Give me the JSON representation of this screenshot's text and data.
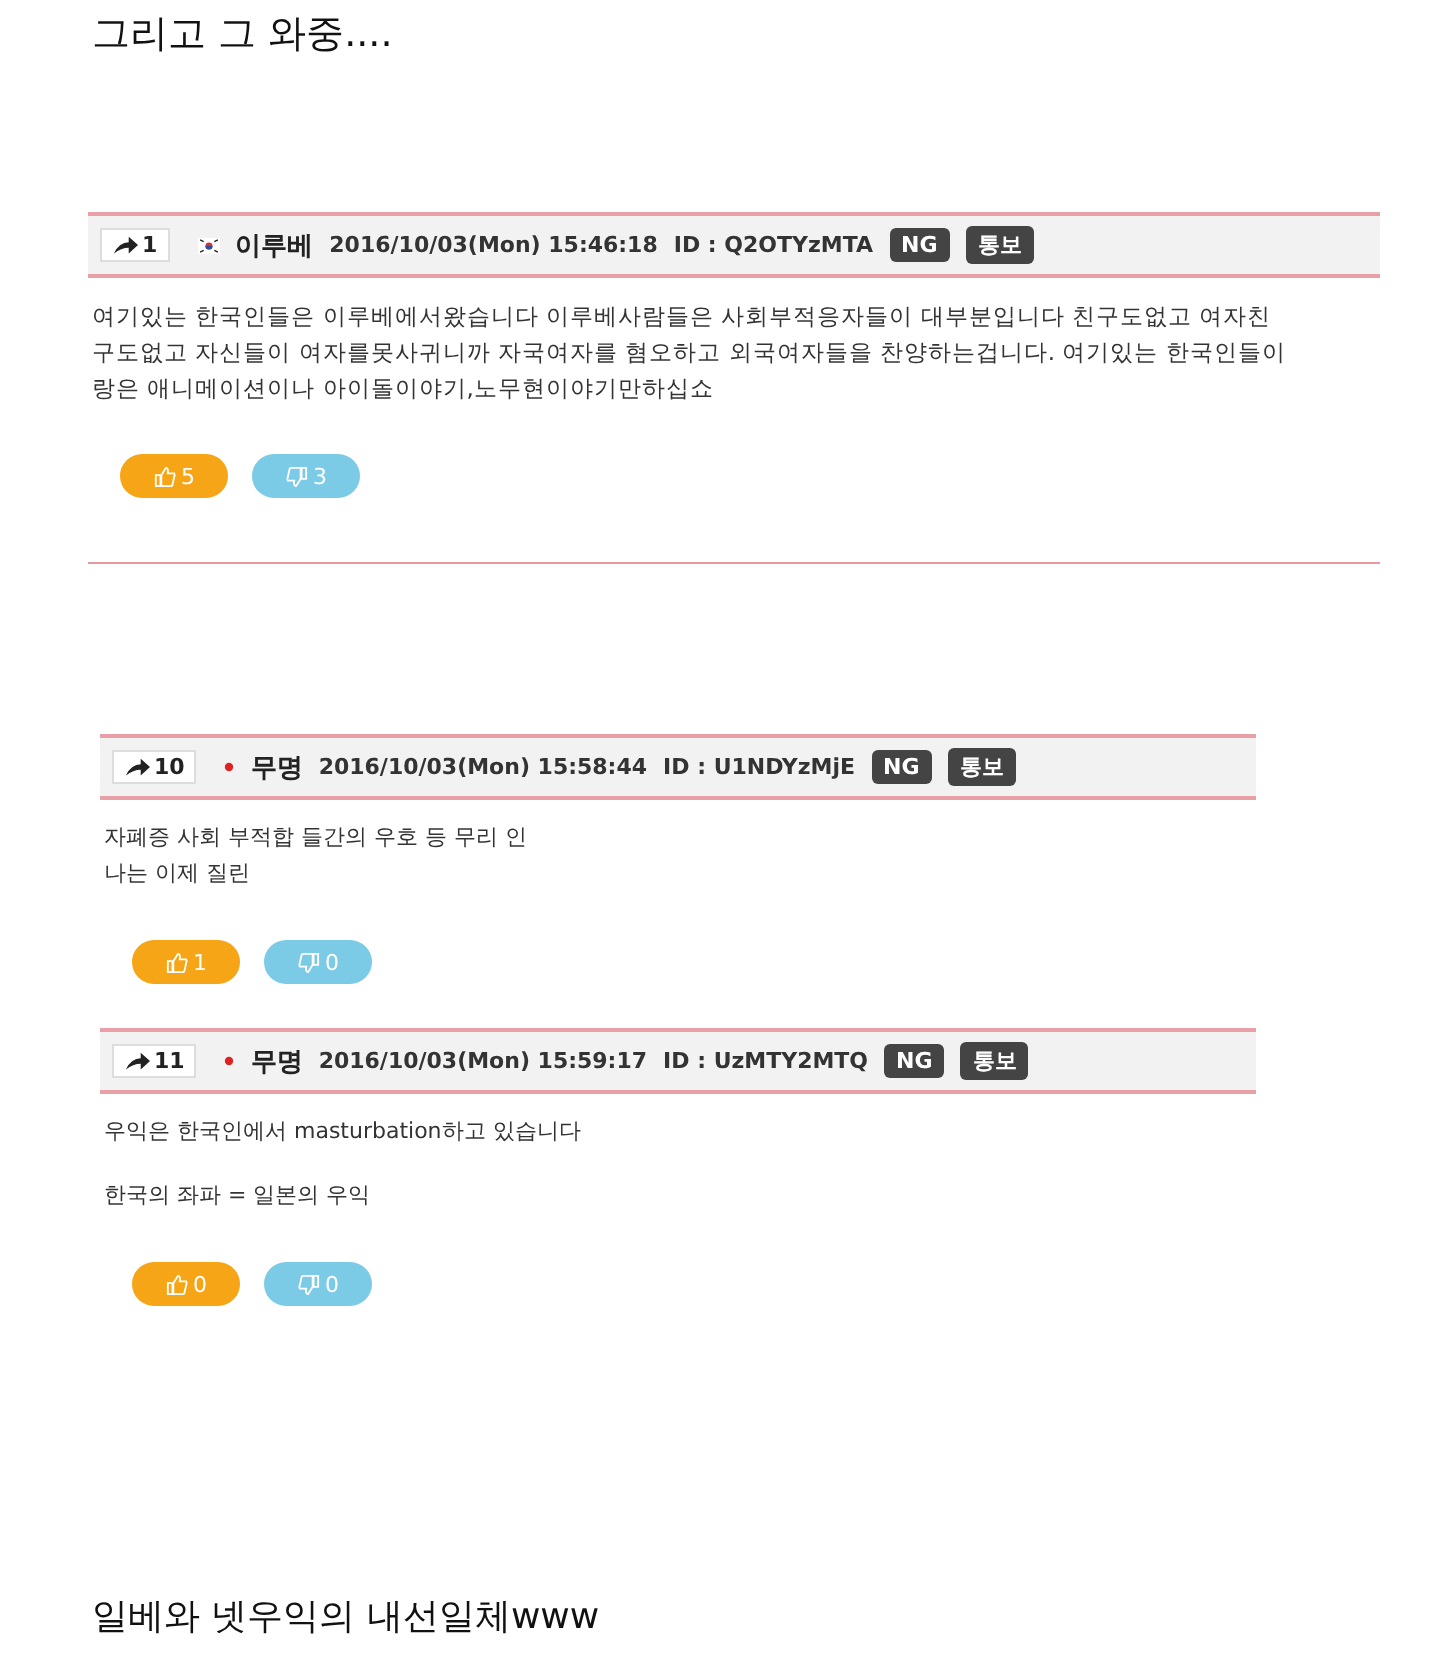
{
  "heading": "그리고 그 와중....",
  "sections": [
    {
      "comments": [
        {
          "number": "1",
          "kind": "flag",
          "name": "이루베",
          "date": "2016/10/03(Mon) 15:46:18",
          "id": "ID : Q2OTYzMTA",
          "ng": "NG",
          "report": "통보",
          "paragraphs": [
            [
              "여기있는 한국인들은 이루베에서왔습니다 이루베사람들은 사회부적응자들이 대부분입니다 친구도없고 여자친",
              "구도없고 자신들이 여자를못사귀니까 자국여자를 혐오하고 외국여자들을 찬양하는겁니다. 여기있는 한국인들이",
              "랑은 애니메이션이나 아이돌이야기,노무현이야기만하십쇼"
            ]
          ],
          "likes": "5",
          "dislikes": "3"
        }
      ]
    },
    {
      "comments": [
        {
          "number": "10",
          "kind": "dot",
          "name": "무명",
          "date": "2016/10/03(Mon) 15:58:44",
          "id": "ID : U1NDYzMjE",
          "ng": "NG",
          "report": "통보",
          "paragraphs": [
            [
              "자폐증 사회 부적합 들간의 우호 등 무리 인",
              "나는 이제 질린"
            ]
          ],
          "likes": "1",
          "dislikes": "0"
        },
        {
          "number": "11",
          "kind": "dot",
          "name": "무명",
          "date": "2016/10/03(Mon) 15:59:17",
          "id": "ID : UzMTY2MTQ",
          "ng": "NG",
          "report": "통보",
          "paragraphs": [
            [
              "우익은 한국인에서 masturbation하고 있습니다"
            ],
            [
              "한국의 좌파 = 일본의 우익"
            ]
          ],
          "likes": "0",
          "dislikes": "0"
        }
      ]
    }
  ],
  "footer": "일베와 넷우익의 내선일체www"
}
